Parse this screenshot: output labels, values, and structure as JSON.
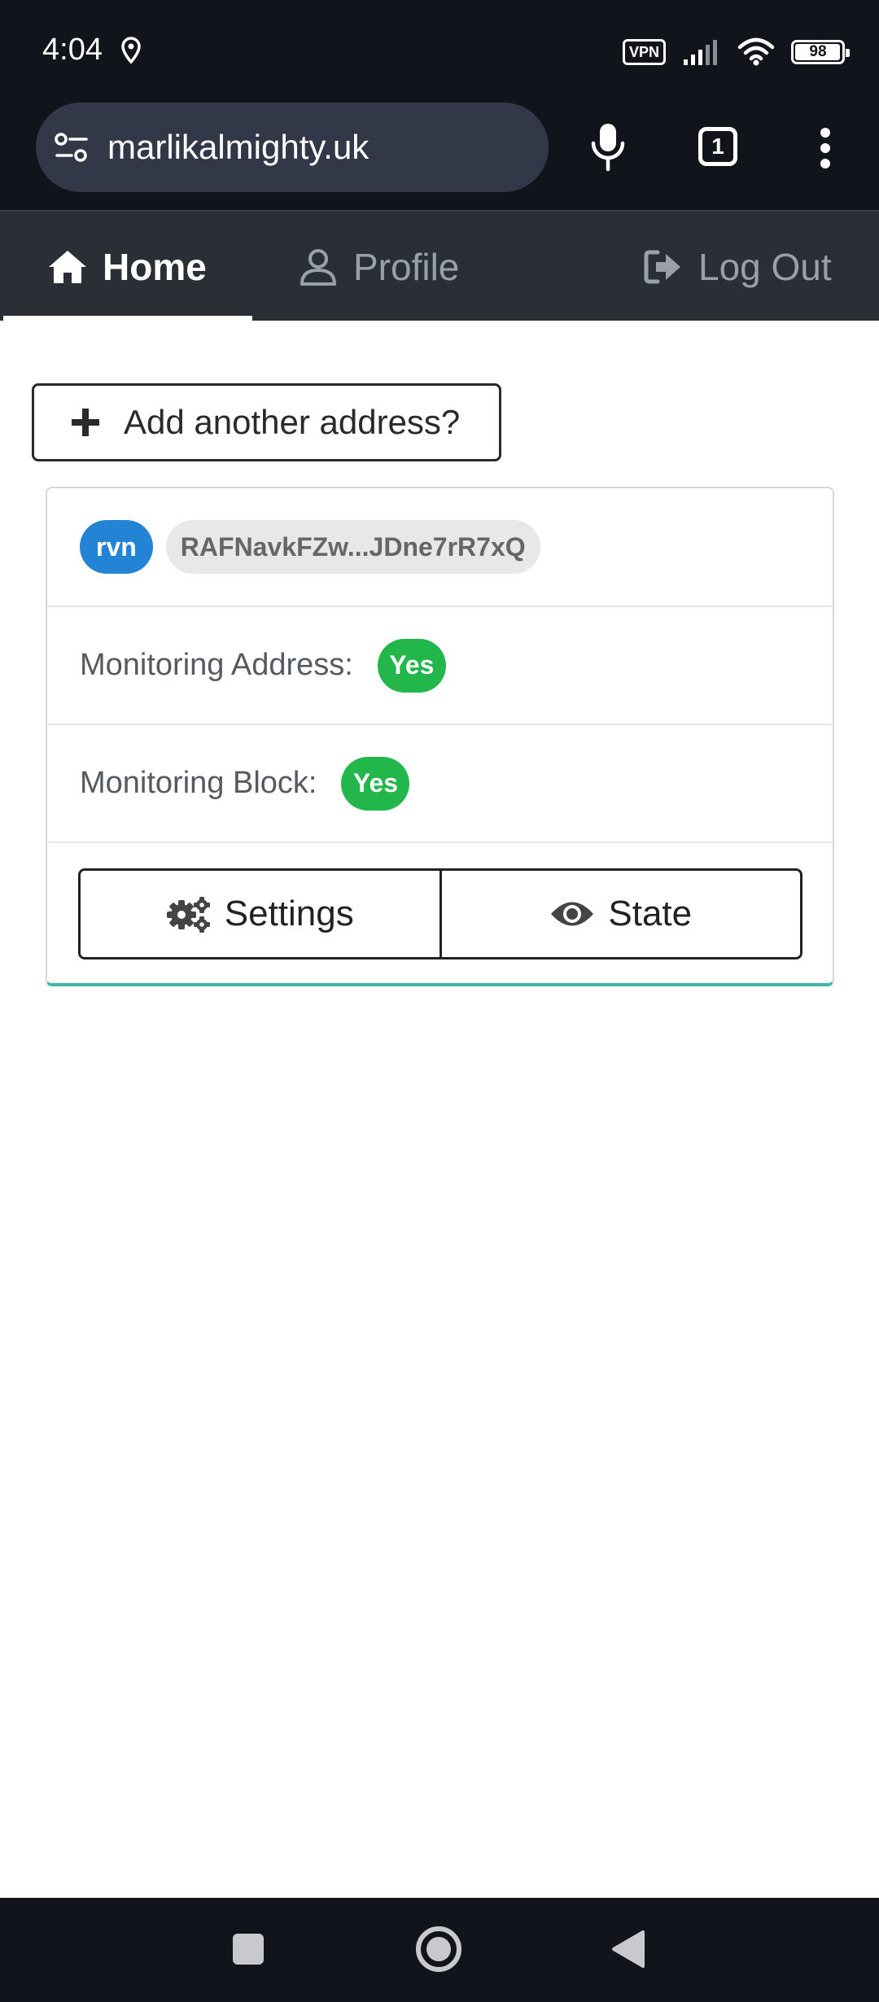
{
  "status_bar": {
    "time": "4:04",
    "vpn": "VPN",
    "battery_percent": 98
  },
  "browser": {
    "url": "marlikalmighty.uk",
    "tab_count": "1"
  },
  "nav": {
    "home": "Home",
    "profile": "Profile",
    "logout": "Log Out"
  },
  "add_address": {
    "label": "Add another address?"
  },
  "card": {
    "coin": "rvn",
    "address": "RAFNavkFZw...JDne7rR7xQ",
    "monitoring_address_label": "Monitoring Address:",
    "monitoring_address_value": "Yes",
    "monitoring_block_label": "Monitoring Block:",
    "monitoring_block_value": "Yes",
    "settings_label": "Settings",
    "state_label": "State"
  },
  "colors": {
    "coin_badge": "#2384d6",
    "yes_badge": "#22b64b",
    "nav_bg": "#2a2f36",
    "card_accent": "#3fb8a9"
  }
}
